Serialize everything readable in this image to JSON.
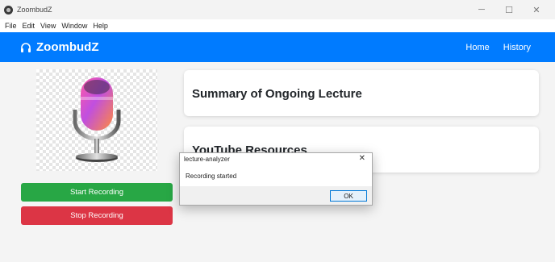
{
  "window": {
    "title": "ZoombudZ",
    "controls": {
      "minimize": "─",
      "maximize": "☐",
      "close": "✕"
    }
  },
  "menubar": {
    "items": [
      {
        "label": "File"
      },
      {
        "label": "Edit"
      },
      {
        "label": "View"
      },
      {
        "label": "Window"
      },
      {
        "label": "Help"
      }
    ]
  },
  "navbar": {
    "brand": "ZoombudZ",
    "brand_icon": "headphones-icon",
    "links": [
      {
        "label": "Home"
      },
      {
        "label": "History"
      }
    ],
    "color": "#007bff"
  },
  "left_panel": {
    "image_icon": "microphone-icon",
    "start_button": "Start Recording",
    "stop_button": "Stop Recording",
    "start_color": "#28a745",
    "stop_color": "#dc3545"
  },
  "main": {
    "summary_title": "Summary of Ongoing Lecture",
    "youtube_title": "YouTube Resources"
  },
  "dialog": {
    "title": "lecture-analyzer",
    "close": "✕",
    "message": "Recording started",
    "ok_label": "OK"
  }
}
